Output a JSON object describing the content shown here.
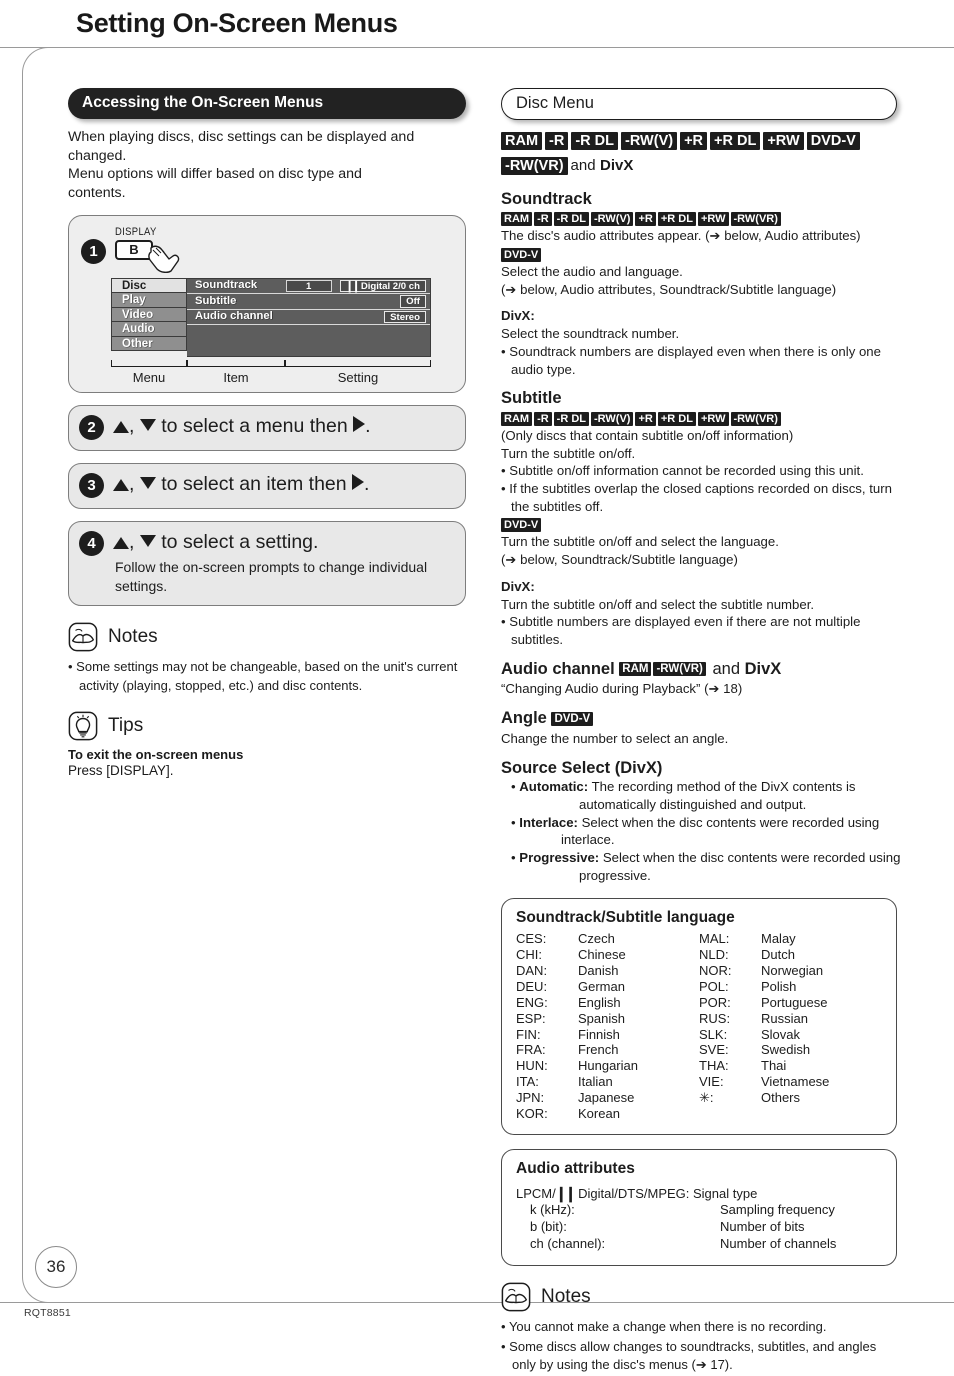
{
  "page": {
    "title": "Setting On-Screen Menus",
    "number": "36",
    "doc_code": "RQT8851"
  },
  "left": {
    "banner": "Accessing the On-Screen Menus",
    "lead": "When playing discs, disc settings can be displayed and changed.\nMenu options will differ based on disc type and contents.",
    "illustration": {
      "step": "1",
      "display_label": "DISPLAY",
      "display_button": "B",
      "menu_items": [
        {
          "label": "Disc",
          "active": true
        },
        {
          "label": "Play",
          "active": false
        },
        {
          "label": "Video",
          "active": false
        },
        {
          "label": "Audio",
          "active": false
        },
        {
          "label": "Other",
          "active": false
        }
      ],
      "rows": [
        {
          "item": "Soundtrack",
          "value": "1",
          "value2_logo": "DD",
          "value2": "Digital   2/0 ch"
        },
        {
          "item": "Subtitle",
          "value": "Off"
        },
        {
          "item": "Audio channel",
          "value": "Stereo"
        }
      ],
      "legend": [
        "Menu",
        "Item",
        "Setting"
      ]
    },
    "steps": [
      {
        "num": "2",
        "pre": "",
        "text_a": "to select a menu then",
        "text_b": ".",
        "sub": ""
      },
      {
        "num": "3",
        "pre": "",
        "text_a": "to select an item then",
        "text_b": ".",
        "sub": ""
      },
      {
        "num": "4",
        "pre": "",
        "text_a": "to select a setting.",
        "text_b": "",
        "sub": "Follow the on-screen prompts to change individual settings."
      }
    ],
    "notes": {
      "title": "Notes",
      "items": [
        "Some settings may not be changeable, based on the unit's current activity (playing, stopped, etc.) and disc contents."
      ]
    },
    "tips": {
      "title": "Tips",
      "heading": "To exit the on-screen menus",
      "line": "Press [DISPLAY]."
    }
  },
  "right": {
    "pill_title": "Disc Menu",
    "header_badges": [
      "RAM",
      "-R",
      "-R DL",
      "-RW(V)",
      "+R",
      "+R DL",
      "+RW",
      "DVD-V",
      "-RW(VR)"
    ],
    "header_suffix_and": "and",
    "header_suffix_divx": "DivX",
    "soundtrack": {
      "heading": "Soundtrack",
      "badges": [
        "RAM",
        "-R",
        "-R DL",
        "-RW(V)",
        "+R",
        "+R DL",
        "+RW",
        "-RW(VR)"
      ],
      "line1": "The disc's audio attributes appear. (➔ below, Audio attributes)",
      "badge2": "DVD-V",
      "line2": "Select the audio and language.",
      "line3": "(➔ below, Audio attributes, Soundtrack/Subtitle language)",
      "divx_label": "DivX:",
      "divx_line": "Select the soundtrack number.",
      "bullet": "Soundtrack numbers are displayed even when there is only one audio type."
    },
    "subtitle": {
      "heading": "Subtitle",
      "badges": [
        "RAM",
        "-R",
        "-R DL",
        "-RW(V)",
        "+R",
        "+R DL",
        "+RW",
        "-RW(VR)"
      ],
      "line1": "(Only discs that contain subtitle on/off information)",
      "line2": "Turn the subtitle on/off.",
      "bullet1": "Subtitle on/off information cannot be recorded using this unit.",
      "bullet2": "If the subtitles overlap the closed captions recorded on discs, turn the subtitles off.",
      "badge2": "DVD-V",
      "line3": "Turn the subtitle on/off and select the language.",
      "line4": "(➔ below, Soundtrack/Subtitle language)",
      "divx_label": "DivX:",
      "divx_line": "Turn the subtitle on/off and select the subtitle number.",
      "bullet3": "Subtitle numbers are displayed even if there are not multiple subtitles."
    },
    "audio_channel": {
      "heading": "Audio channel",
      "badges": [
        "RAM",
        "-RW(VR)"
      ],
      "and": "and",
      "divx": "DivX",
      "line": "“Changing Audio during Playback” (➔ 18)"
    },
    "angle": {
      "heading": "Angle",
      "badge": "DVD-V",
      "line": "Change the number to select an angle."
    },
    "source_select": {
      "heading": "Source Select (DivX)",
      "items": [
        {
          "label": "Automatic:",
          "text": "The recording method of the DivX contents is",
          "cont": "automatically distinguished and output."
        },
        {
          "label": "Interlace:",
          "text": "Select when the disc contents were recorded using",
          "cont": "interlace."
        },
        {
          "label": "Progressive:",
          "text": "Select when the disc contents were recorded using",
          "cont": "progressive."
        }
      ]
    },
    "language_box": {
      "title": "Soundtrack/Subtitle language",
      "left": [
        {
          "code": "CES:",
          "name": "Czech"
        },
        {
          "code": "CHI:",
          "name": "Chinese"
        },
        {
          "code": "DAN:",
          "name": "Danish"
        },
        {
          "code": "DEU:",
          "name": "German"
        },
        {
          "code": "ENG:",
          "name": "English"
        },
        {
          "code": "ESP:",
          "name": "Spanish"
        },
        {
          "code": "FIN:",
          "name": "Finnish"
        },
        {
          "code": "FRA:",
          "name": "French"
        },
        {
          "code": "HUN:",
          "name": "Hungarian"
        },
        {
          "code": "ITA:",
          "name": "Italian"
        },
        {
          "code": "JPN:",
          "name": "Japanese"
        },
        {
          "code": "KOR:",
          "name": "Korean"
        }
      ],
      "right": [
        {
          "code": "MAL:",
          "name": "Malay"
        },
        {
          "code": "NLD:",
          "name": "Dutch"
        },
        {
          "code": "NOR:",
          "name": "Norwegian"
        },
        {
          "code": "POL:",
          "name": "Polish"
        },
        {
          "code": "POR:",
          "name": "Portuguese"
        },
        {
          "code": "RUS:",
          "name": "Russian"
        },
        {
          "code": "SLK:",
          "name": "Slovak"
        },
        {
          "code": "SVE:",
          "name": "Swedish"
        },
        {
          "code": "THA:",
          "name": "Thai"
        },
        {
          "code": "VIE:",
          "name": "Vietnamese"
        },
        {
          "code": "✳:",
          "name": "Others"
        }
      ]
    },
    "audio_box": {
      "title": "Audio attributes",
      "signal_pre": "LPCM/",
      "signal_logo": "DD",
      "signal_post": " Digital/DTS/MPEG: Signal type",
      "rows": [
        {
          "key": "k (kHz):",
          "value": "Sampling frequency"
        },
        {
          "key": "b (bit):",
          "value": "Number of bits"
        },
        {
          "key": "ch (channel):",
          "value": "Number of channels"
        }
      ]
    },
    "notes": {
      "title": "Notes",
      "items": [
        "You cannot make a change when there is no recording.",
        "Some discs allow changes to soundtracks, subtitles, and angles only by using the disc's menus (➔ 17)."
      ]
    }
  }
}
